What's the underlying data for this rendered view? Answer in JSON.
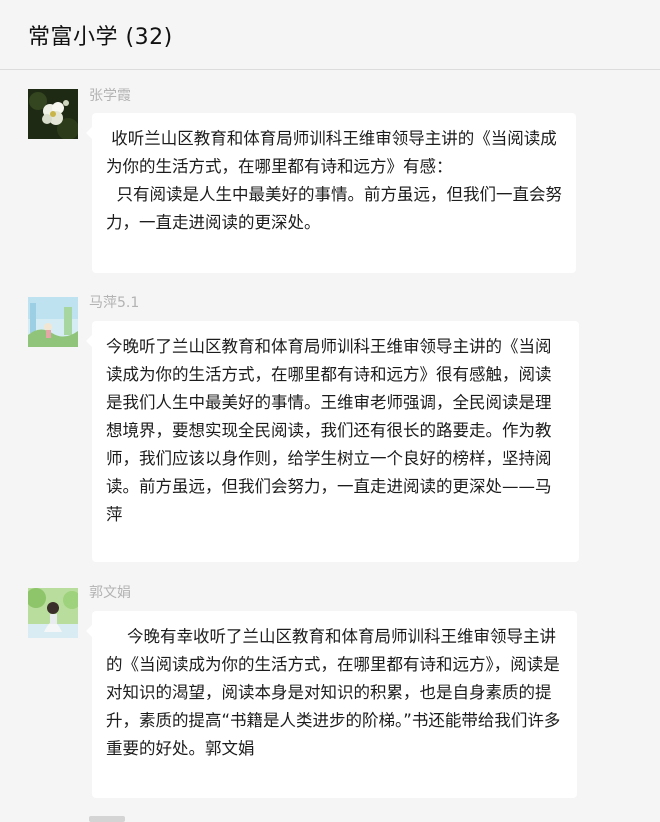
{
  "chat": {
    "title": "常富小学 (32)"
  },
  "messages": [
    {
      "sender": "张学霞",
      "avatar_icon": "flower-photo-icon",
      "text": " 收听兰山区教育和体育局师训科王维审领导主讲的《当阅读成为你的生活方式，在哪里都有诗和远方》有感：\n  只有阅读是人生中最美好的事情。前方虽远，但我们一直会努力，一直走进阅读的更深处。"
    },
    {
      "sender": "马萍5.1",
      "avatar_icon": "landscape-photo-icon",
      "text": "今晚听了兰山区教育和体育局师训科王维审领导主讲的《当阅读成为你的生活方式，在哪里都有诗和远方》很有感触，阅读是我们人生中最美好的事情。王维审老师强调，全民阅读是理想境界，要想实现全民阅读，我们还有很长的路要走。作为教师，我们应该以身作则，给学生树立一个良好的榜样，坚持阅读。前方虽远，但我们会努力，一直走进阅读的更深处——马萍"
    },
    {
      "sender": "郭文娟",
      "avatar_icon": "person-photo-icon",
      "text": "    今晚有幸收听了兰山区教育和体育局师训科王维审领导主讲的《当阅读成为你的生活方式，在哪里都有诗和远方》，阅读是对知识的渴望，阅读本身是对知识的积累，也是自身素质的提升，素质的提高“书籍是人类进步的阶梯。”书还能带给我们许多重要的好处。郭文娟"
    }
  ]
}
